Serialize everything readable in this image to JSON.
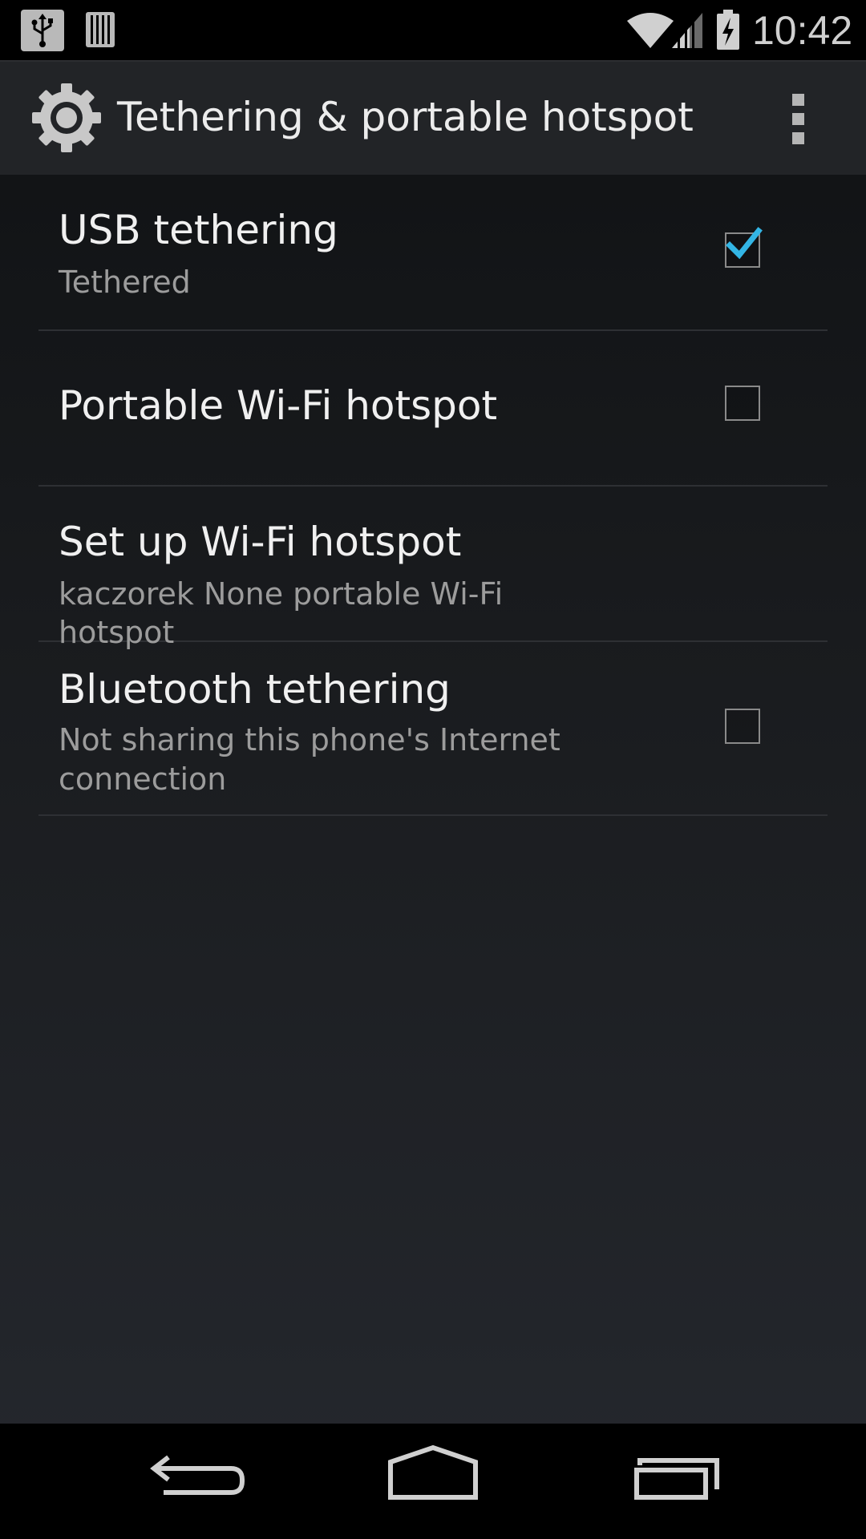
{
  "status_bar": {
    "time": "10:42",
    "icons": [
      "usb-icon",
      "storage-icon",
      "wifi-icon",
      "signal-icon",
      "battery-charging-icon"
    ]
  },
  "action_bar": {
    "title": "Tethering & portable hotspot",
    "icon": "settings-gear-icon",
    "overflow_icon": "overflow-menu-icon"
  },
  "preferences": [
    {
      "title": "USB tethering",
      "summary": "Tethered",
      "checked": true
    },
    {
      "title": "Portable Wi-Fi hotspot",
      "summary": "",
      "checked": false
    },
    {
      "title": "Set up Wi-Fi hotspot",
      "summary": "kaczorek None portable Wi-Fi hotspot"
    },
    {
      "title": "Bluetooth tethering",
      "summary": "Not sharing this phone's Internet connection",
      "checked": false
    }
  ],
  "colors": {
    "accent": "#33b5e5",
    "status_bar_bg": "#000000",
    "action_bar_bg": "#222427",
    "text_primary": "#f0f0f0",
    "text_secondary": "#9c9c9c"
  },
  "nav_bar": {
    "icons": [
      "back-icon",
      "home-icon",
      "recent-apps-icon"
    ]
  }
}
